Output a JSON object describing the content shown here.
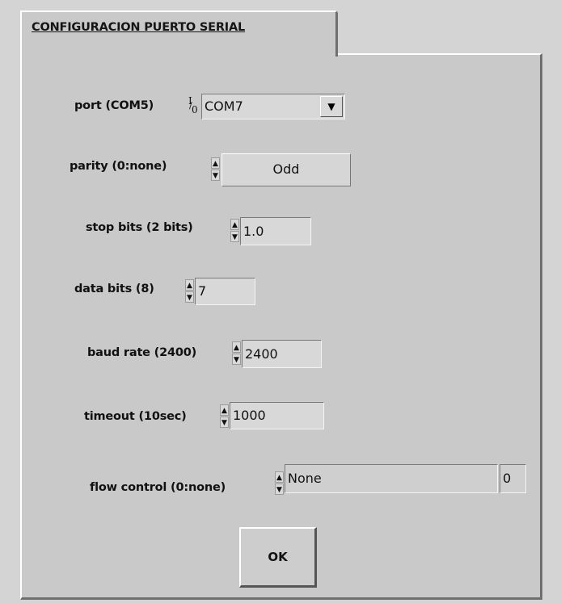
{
  "tab": {
    "label": "CONFIGURACION PUERTO SERIAL"
  },
  "fields": {
    "port": {
      "label": "port (COM5)",
      "value": "COM7",
      "io_icon": "I/0"
    },
    "parity": {
      "label": "parity (0:none)",
      "value": "Odd"
    },
    "stop_bits": {
      "label": "stop bits (2 bits)",
      "value": "1.0"
    },
    "data_bits": {
      "label": "data bits (8)",
      "value": "7"
    },
    "baud_rate": {
      "label": "baud rate (2400)",
      "value": "2400"
    },
    "timeout": {
      "label": "timeout (10sec)",
      "value": "1000"
    },
    "flow_control": {
      "label": "flow control (0:none)",
      "value": "None",
      "index": "0"
    }
  },
  "ok_button": {
    "label": "OK"
  },
  "icons": {
    "spinner_up": "▲",
    "spinner_down": "▼",
    "dropdown": "▼"
  },
  "colors": {
    "panel": "#c9c9c9",
    "field": "#d8d8d8",
    "text": "#111111"
  }
}
